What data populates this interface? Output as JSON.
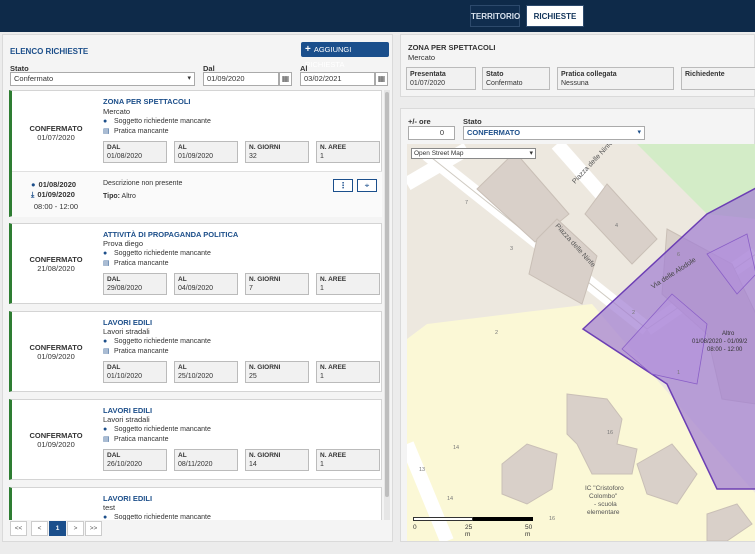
{
  "nav": {
    "tabs": [
      "TERRITORIO",
      "RICHIESTE"
    ]
  },
  "list_panel": {
    "title": "ELENCO RICHIESTE",
    "add_label": "AGGIUNGI RICHIESTA",
    "stato_label": "Stato",
    "stato_value": "Confermato",
    "dal_label": "Dal",
    "dal_value": "01/09/2020",
    "al_label": "Al",
    "al_value": "03/02/2021"
  },
  "box_labels": {
    "dal": "DAL",
    "al": "AL",
    "giorni": "N. GIORNI",
    "aree": "N. AREE"
  },
  "info_labels": {
    "soggetto": "Soggetto richiedente mancante",
    "pratica": "Pratica mancante"
  },
  "cards": [
    {
      "state": "CONFERMATO",
      "date": "01/07/2020",
      "title": "ZONA PER SPETTACOLI",
      "subtitle": "Mercato",
      "dal": "01/08/2020",
      "al": "01/09/2020",
      "giorni": "32",
      "aree": "1"
    },
    {
      "state": "CONFERMATO",
      "date": "21/08/2020",
      "title": "ATTIVITÀ DI PROPAGANDA POLITICA",
      "subtitle": "Prova diego",
      "dal": "29/08/2020",
      "al": "04/09/2020",
      "giorni": "7",
      "aree": "1"
    },
    {
      "state": "CONFERMATO",
      "date": "01/09/2020",
      "title": "LAVORI EDILI",
      "subtitle": "Lavori stradali",
      "dal": "01/10/2020",
      "al": "25/10/2020",
      "giorni": "25",
      "aree": "1"
    },
    {
      "state": "CONFERMATO",
      "date": "01/09/2020",
      "title": "LAVORI EDILI",
      "subtitle": "Lavori stradali",
      "dal": "26/10/2020",
      "al": "08/11/2020",
      "giorni": "14",
      "aree": "1"
    },
    {
      "state": "",
      "date": "",
      "title": "LAVORI EDILI",
      "subtitle": "test",
      "dal": "",
      "al": "",
      "giorni": "",
      "aree": ""
    }
  ],
  "detail": {
    "from": "01/08/2020",
    "to": "01/09/2020",
    "hours": "08:00 - 12:00",
    "description": "Descrizione non presente",
    "tipo_label": "Tipo:",
    "tipo_value": "Altro"
  },
  "pager": {
    "first": "<<",
    "prev": "<",
    "current": "1",
    "next": ">",
    "last": ">>"
  },
  "zone_info": {
    "title": "ZONA PER SPETTACOLI",
    "subtitle": "Mercato",
    "presentata_label": "Presentata",
    "presentata_value": "01/07/2020",
    "stato_label": "Stato",
    "stato_value": "Confermato",
    "pratica_label": "Pratica collegata",
    "pratica_value": "Nessuna",
    "richiedente_label": "Richiedente"
  },
  "map_panel": {
    "ore_label": "+/- ore",
    "ore_value": "0",
    "stato_label": "Stato",
    "stato_value": "CONFERMATO",
    "layer_value": "Open Street Map",
    "streets": [
      "Piazza delle Ninfe",
      "Piazza delle Ninfe",
      "Via delle Alodole"
    ],
    "zone_label": [
      "Altro",
      "01/08/2020 - 01/09/2",
      "08:00 - 12:00"
    ],
    "school_label": [
      "IC \"Cristoforo",
      "Colombo\"",
      "- scuola",
      "elementare"
    ],
    "house_numbers": [
      "7",
      "4",
      "3",
      "6",
      "2",
      "14",
      "13",
      "14",
      "16",
      "16",
      "2",
      "1"
    ],
    "scale_labels": [
      "0",
      "25 m",
      "50 m"
    ]
  },
  "colors": {
    "navbar": "#0e2a49",
    "accent": "#1b4f8c",
    "status_bar": "#2e7d32",
    "zone_fill": "#a27fd3"
  }
}
